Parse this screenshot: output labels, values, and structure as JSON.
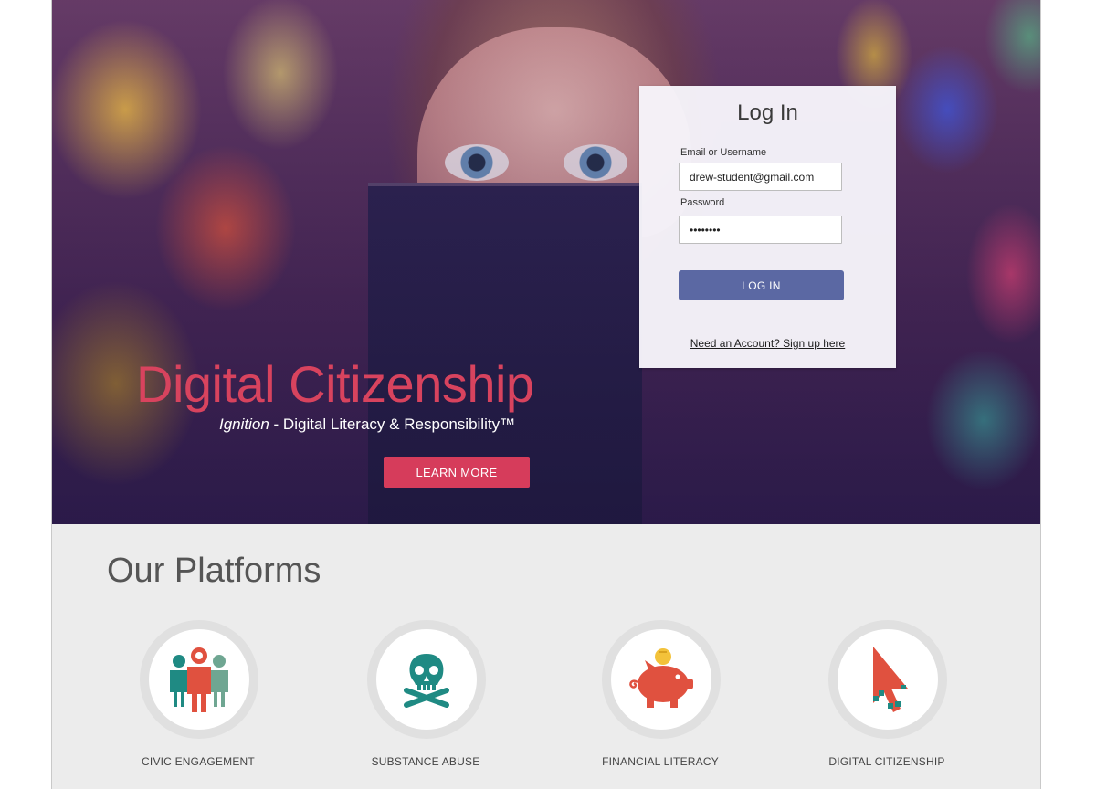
{
  "hero": {
    "title": "Digital Citizenship",
    "subtitle_brand": "Ignition",
    "subtitle_rest": " - Digital Literacy & Responsibility™",
    "learn_more_label": "LEARN MORE"
  },
  "login": {
    "title": "Log In",
    "email_label": "Email or Username",
    "email_value": "drew-student@gmail.com",
    "password_label": "Password",
    "password_value": "••••••••",
    "submit_label": "LOG IN",
    "signup_link": "Need an Account? Sign up here"
  },
  "platforms": {
    "title": "Our Platforms",
    "items": [
      {
        "label": "CIVIC ENGAGEMENT",
        "icon": "people-icon"
      },
      {
        "label": "SUBSTANCE ABUSE",
        "icon": "skull-crossbones-icon"
      },
      {
        "label": "FINANCIAL LITERACY",
        "icon": "piggy-bank-icon"
      },
      {
        "label": "DIGITAL CITIZENSHIP",
        "icon": "cursor-arrow-icon"
      }
    ]
  },
  "colors": {
    "accent_red": "#d63c5b",
    "login_button": "#5b68a3",
    "teal": "#1f8a83",
    "coral": "#e0513f"
  }
}
